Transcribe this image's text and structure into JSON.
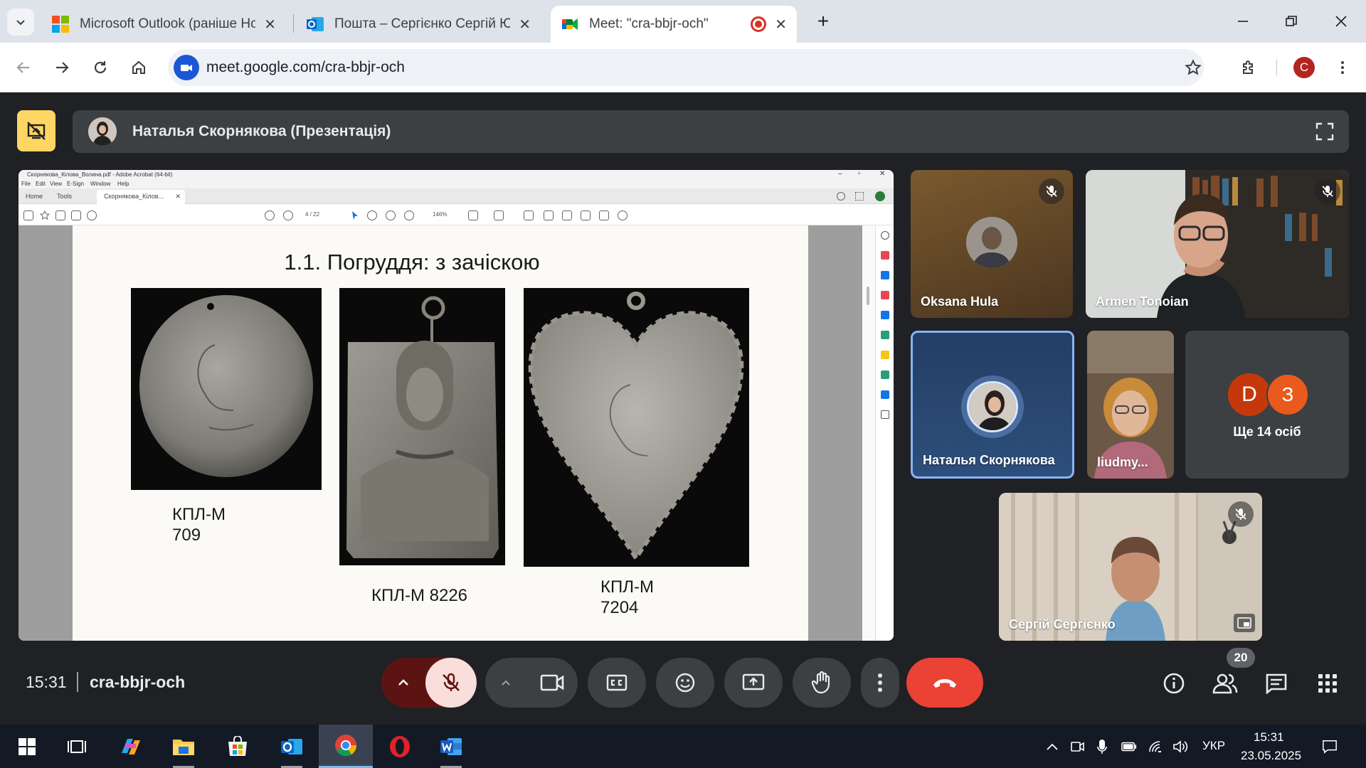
{
  "browser": {
    "tabs": [
      {
        "title": "Microsoft Outlook (раніше Hot",
        "icon": "microsoft-icon"
      },
      {
        "title": "Пошта – Сергієнко Сергій Юрі",
        "icon": "outlook-icon"
      },
      {
        "title": "Meet: \"cra-bbjr-och\"",
        "icon": "meet-icon",
        "active": true
      }
    ],
    "url": "meet.google.com/cra-bbjr-och",
    "profile_initial": "C",
    "new_tab_label": "+"
  },
  "meet": {
    "presenter_title": "Наталья Скорнякова (Презентація)",
    "clock": "15:31",
    "meeting_code": "cra-bbjr-och",
    "people_count": "20",
    "participants": [
      {
        "name": "Oksana Hula",
        "muted": true
      },
      {
        "name": "Armen Tonoian",
        "muted": true
      },
      {
        "name": "Наталья Скорнякова",
        "muted": false
      },
      {
        "name": "liudmy...",
        "muted": false
      },
      {
        "name": "Сергій Сергієнко",
        "muted": true
      }
    ],
    "more_tile": {
      "initials": [
        "D",
        "З"
      ],
      "label": "Ще 14 осіб"
    },
    "colors": {
      "end_call": "#ea4335",
      "mic_off_bg": "#f9dedc",
      "accent_pin": "#fdd663"
    }
  },
  "acrobat": {
    "window_title": "Скорнякова_Кілова_Волина.pdf - Adobe Acrobat (64-bit)",
    "menu": [
      "File",
      "Edit",
      "View",
      "E-Sign",
      "Window",
      "Help"
    ],
    "tabs": {
      "home": "Home",
      "tools": "Tools",
      "doc": "Скорнякова_Кілов..."
    },
    "page_indicator": "4 / 22",
    "zoom": "146%"
  },
  "slide": {
    "title": "1.1. Погруддя: з зачіскою",
    "captions": [
      "КПЛ-М 709",
      "КПЛ-М 8226",
      "КПЛ-М 7204"
    ]
  },
  "taskbar": {
    "language": "УКР",
    "time": "15:31",
    "date": "23.05.2025"
  }
}
